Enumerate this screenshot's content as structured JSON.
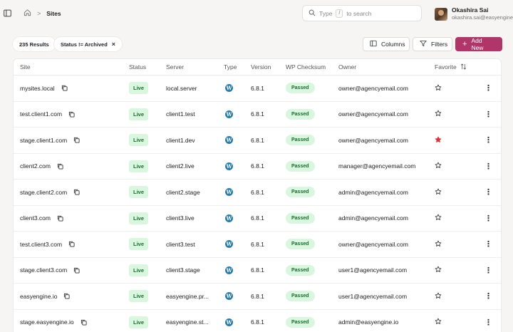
{
  "breadcrumb": {
    "current": "Sites",
    "separator": ">"
  },
  "search": {
    "placeholder": "Type",
    "shortcut": "/",
    "suffix": "to search"
  },
  "user": {
    "name": "Okashira Sai",
    "email": "okashira.sai@easyengine.io"
  },
  "toolbar": {
    "results": "235 Results",
    "filter_chip": "Status != Archived",
    "columns_label": "Columns",
    "filters_label": "Filters",
    "add_new_label": "Add New"
  },
  "table": {
    "headers": {
      "site": "Site",
      "status": "Status",
      "server": "Server",
      "type": "Type",
      "version": "Version",
      "checksum": "WP Checksum",
      "owner": "Owner",
      "favorite": "Favorite"
    },
    "rows": [
      {
        "site": "mysites.local",
        "status": "Live",
        "server": "local.server",
        "version": "6.8.1",
        "checksum": "Passed",
        "owner": "owner@agencyemail.com",
        "favorite": false
      },
      {
        "site": "test.client1.com",
        "status": "Live",
        "server": "client1.test",
        "version": "6.8.1",
        "checksum": "Passed",
        "owner": "owner@agencyemail.com",
        "favorite": false
      },
      {
        "site": "stage.client1.com",
        "status": "Live",
        "server": "client1.dev",
        "version": "6.8.1",
        "checksum": "Passed",
        "owner": "owner@agencyemail.com",
        "favorite": true
      },
      {
        "site": "client2.com",
        "status": "Live",
        "server": "client2.live",
        "version": "6.8.1",
        "checksum": "Passed",
        "owner": "manager@agencyemail.com",
        "favorite": false
      },
      {
        "site": "stage.client2.com",
        "status": "Live",
        "server": "client2.stage",
        "version": "6.8.1",
        "checksum": "Passed",
        "owner": "admin@agencyemail.com",
        "favorite": false
      },
      {
        "site": "client3.com",
        "status": "Live",
        "server": "client3.live",
        "version": "6.8.1",
        "checksum": "Passed",
        "owner": "admin@agencyemail.com",
        "favorite": false
      },
      {
        "site": "test.client3.com",
        "status": "Live",
        "server": "client3.test",
        "version": "6.8.1",
        "checksum": "Passed",
        "owner": "owner@agencyemail.com",
        "favorite": false
      },
      {
        "site": "stage.client3.com",
        "status": "Live",
        "server": "client3.stage",
        "version": "6.8.1",
        "checksum": "Passed",
        "owner": "user1@agencyemail.com",
        "favorite": false
      },
      {
        "site": "easyengine.io",
        "status": "Live",
        "server": "easyengine.pr...",
        "version": "6.8.1",
        "checksum": "Passed",
        "owner": "user1@agencyemail.com",
        "favorite": false
      },
      {
        "site": "stage.easyengine.io",
        "status": "Live",
        "server": "easyengine.st...",
        "version": "6.8.1",
        "checksum": "Passed",
        "owner": "admin@easyengine.io",
        "favorite": false
      }
    ]
  },
  "colors": {
    "accent": "#b0366a",
    "favorite_active": "#d8323c",
    "live_bg": "#d9f6df",
    "wp_blue": "#2a7ea8"
  }
}
